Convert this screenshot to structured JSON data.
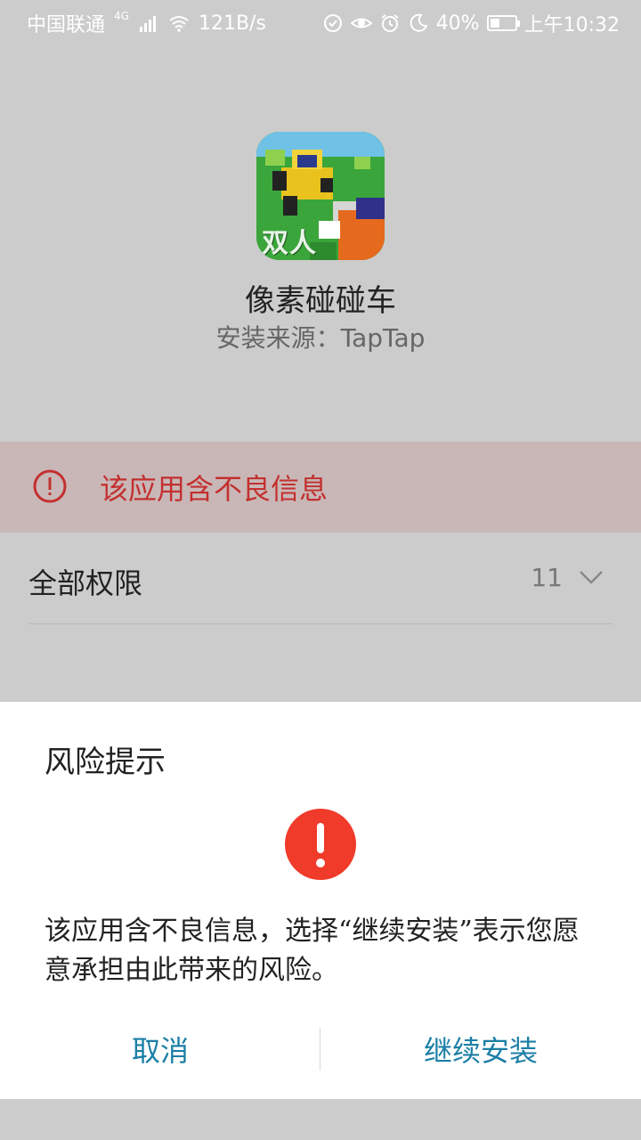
{
  "status_bar": {
    "carrier": "中国联通",
    "network": "4G",
    "speed": "121B/s",
    "battery": "40%",
    "battery_level": 0.4,
    "time": "上午10:32"
  },
  "app": {
    "name": "像素碰碰车",
    "source": "安装来源：TapTap",
    "icon_overlay_text": "双人"
  },
  "warning": {
    "text": "该应用含不良信息"
  },
  "permissions": {
    "label": "全部权限",
    "count": "11"
  },
  "dialog": {
    "title": "风险提示",
    "message": "该应用含不良信息，选择“继续安装”表示您愿意承担由此带来的风险。",
    "cancel_label": "取消",
    "continue_label": "继续安装"
  },
  "colors": {
    "accent": "#1b7fa6",
    "danger": "#c3302f",
    "alert_red": "#f03a2a"
  }
}
